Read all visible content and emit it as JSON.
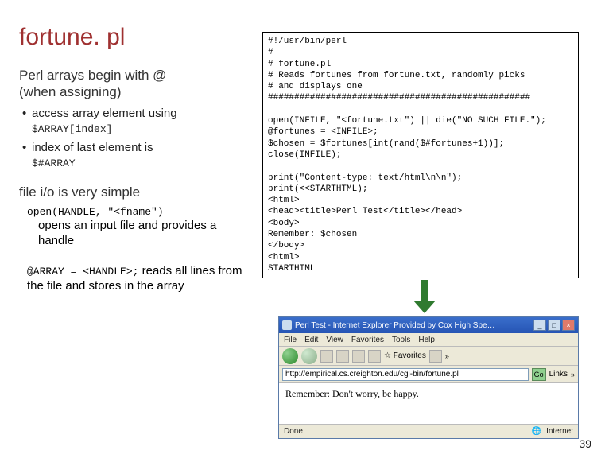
{
  "title": "fortune. pl",
  "left": {
    "sub1a": "Perl arrays begin with @",
    "sub1b": "(when assigning)",
    "b1a": "access array element using ",
    "b1code": "$ARRAY[index]",
    "b2a": "index of last element is",
    "b2code": "$#ARRAY",
    "sub2": "file i/o is very simple",
    "opencode": "open(HANDLE, \"<fname\")",
    "open_desc": "opens an input file and provides a handle",
    "readcode": "@ARRAY = <HANDLE>;",
    "read_desc": " reads all lines from the file and stores in the array"
  },
  "code": "#!/usr/bin/perl\n#\n# fortune.pl\n# Reads fortunes from fortune.txt, randomly picks\n# and displays one\n##################################################\n\nopen(INFILE, \"<fortune.txt\") || die(\"NO SUCH FILE.\");\n@fortunes = <INFILE>;\n$chosen = $fortunes[int(rand($#fortunes+1))];\nclose(INFILE);\n\nprint(\"Content-type: text/html\\n\\n\");\nprint(<<STARTHTML);\n<html>\n<head><title>Perl Test</title></head>\n<body>\nRemember: $chosen\n</body>\n<html>\nSTARTHTML",
  "browser": {
    "title": "Perl Test - Internet Explorer Provided by Cox High Spe…",
    "menu": [
      "File",
      "Edit",
      "View",
      "Favorites",
      "Tools",
      "Help"
    ],
    "fav_label": "Favorites",
    "url": "http://empirical.cs.creighton.edu/cgi-bin/fortune.pl",
    "go": "Go",
    "links": "Links",
    "content": "Remember: Don't worry, be happy.",
    "status_done": "Done",
    "status_zone": "Internet"
  },
  "pagenum": "39"
}
